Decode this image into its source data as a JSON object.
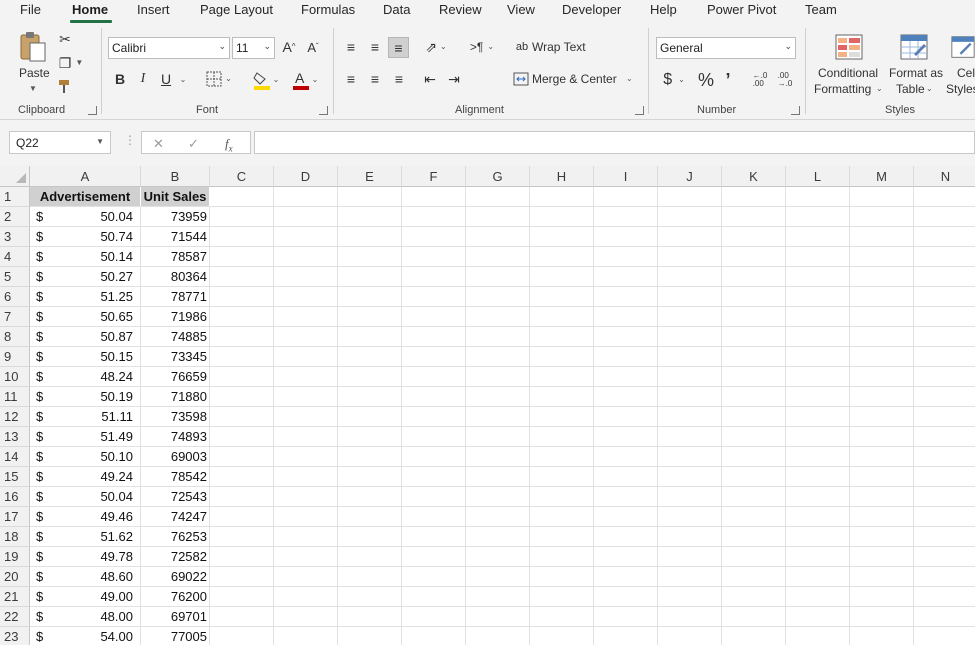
{
  "tabs": [
    "File",
    "Home",
    "Insert",
    "Page Layout",
    "Formulas",
    "Data",
    "Review",
    "View",
    "Developer",
    "Help",
    "Power Pivot",
    "Team"
  ],
  "active_tab": "Home",
  "ribbon": {
    "clipboard": {
      "paste_label": "Paste",
      "group_label": "Clipboard"
    },
    "font": {
      "font_name": "Calibri",
      "font_size": "11",
      "group_label": "Font",
      "bold": "B",
      "italic": "I",
      "underline": "U"
    },
    "alignment": {
      "wrap_text": "Wrap Text",
      "merge_center": "Merge & Center",
      "group_label": "Alignment"
    },
    "number": {
      "format": "General",
      "group_label": "Number"
    },
    "styles": {
      "conditional_1": "Conditional",
      "conditional_2": "Formatting",
      "format_table_1": "Format as",
      "format_table_2": "Table",
      "cell_styles_1": "Cell",
      "cell_styles_2": "Styles",
      "group_label": "Styles"
    }
  },
  "formula_bar": {
    "name_box": "Q22",
    "formula": ""
  },
  "columns": [
    "A",
    "B",
    "C",
    "D",
    "E",
    "F",
    "G",
    "H",
    "I",
    "J",
    "K",
    "L",
    "M",
    "N"
  ],
  "row_numbers": [
    "1",
    "2",
    "3",
    "4",
    "5",
    "6",
    "7",
    "8",
    "9",
    "10",
    "11",
    "12",
    "13",
    "14",
    "15",
    "16",
    "17",
    "18",
    "19",
    "20",
    "21",
    "22",
    "23"
  ],
  "table": {
    "headers": [
      "Advertisement",
      "Unit Sales"
    ],
    "currency_symbol": "$",
    "rows": [
      [
        "50.04",
        "73959"
      ],
      [
        "50.74",
        "71544"
      ],
      [
        "50.14",
        "78587"
      ],
      [
        "50.27",
        "80364"
      ],
      [
        "51.25",
        "78771"
      ],
      [
        "50.65",
        "71986"
      ],
      [
        "50.87",
        "74885"
      ],
      [
        "50.15",
        "73345"
      ],
      [
        "48.24",
        "76659"
      ],
      [
        "50.19",
        "71880"
      ],
      [
        "51.11",
        "73598"
      ],
      [
        "51.49",
        "74893"
      ],
      [
        "50.10",
        "69003"
      ],
      [
        "49.24",
        "78542"
      ],
      [
        "50.04",
        "72543"
      ],
      [
        "49.46",
        "74247"
      ],
      [
        "51.62",
        "76253"
      ],
      [
        "49.78",
        "72582"
      ],
      [
        "48.60",
        "69022"
      ],
      [
        "49.00",
        "76200"
      ],
      [
        "48.00",
        "69701"
      ],
      [
        "54.00",
        "77005"
      ]
    ]
  },
  "colors": {
    "accent": "#217346",
    "header_fill": "#d0d0d0"
  }
}
